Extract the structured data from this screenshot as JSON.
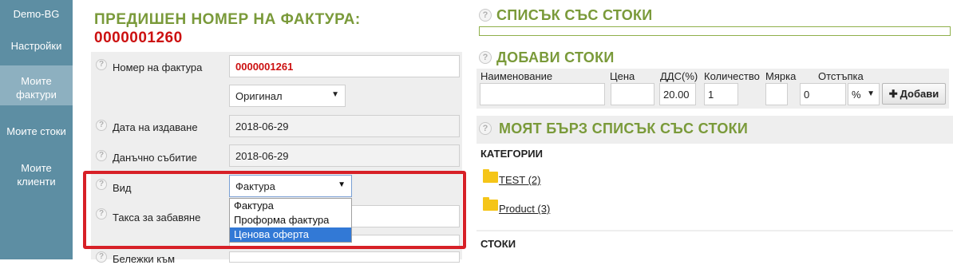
{
  "sidebar": {
    "items": [
      {
        "label": "Demo-BG"
      },
      {
        "label": "Настройки"
      },
      {
        "label": "Моите фактури"
      },
      {
        "label": "Моите стоки"
      },
      {
        "label": "Моите клиенти"
      }
    ]
  },
  "invoice": {
    "prev_title": "ПРЕДИШЕН НОМЕР НА ФАКТУРА:",
    "prev_number": "0000001260",
    "number_label": "Номер на фактура",
    "number_value": "0000001261",
    "copy_type_value": "Оригинал",
    "issue_date_label": "Дата на издаване",
    "issue_date_value": "2018-06-29",
    "tax_event_label": "Данъчно събитие",
    "tax_event_value": "2018-06-29",
    "type_label": "Вид",
    "type_value": "Фактура",
    "late_fee_label": "Такса за забавяне",
    "notes_label": "Бележки към",
    "type_options": [
      "Фактура",
      "Проформа фактура",
      "Ценова оферта"
    ]
  },
  "right": {
    "stock_list_title": "СПИСЪК СЪС СТОКИ",
    "add_title": "ДОБАВИ СТОКИ",
    "cols": {
      "name": "Наименование",
      "price": "Цена",
      "vat": "ДДС(%)",
      "qty": "Количество",
      "unit": "Мярка",
      "discount": "Отстъпка"
    },
    "vat_value": "20.00",
    "qty_value": "1",
    "discount_value": "0",
    "discount_unit": "%",
    "add_button": "Добави",
    "quick_title": "МОЯТ БЪРЗ СПИСЪК СЪС СТОКИ",
    "categories_label": "КАТЕГОРИИ",
    "categories": [
      {
        "label": "TEST (2)"
      },
      {
        "label": "Product (3)"
      }
    ],
    "stock_label": "СТОКИ"
  },
  "colors": {
    "sidebar": "#5d8ea3",
    "sidebar_active": "#8db0c0",
    "heading_green": "#7a9a3a",
    "red": "#cc1111",
    "highlight_box": "#d72027",
    "selected_option": "#3279d6"
  }
}
